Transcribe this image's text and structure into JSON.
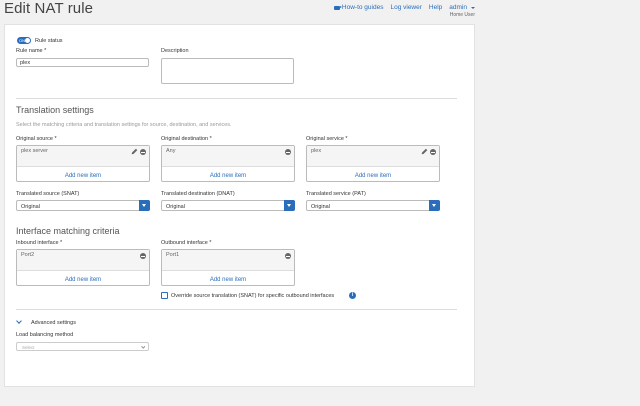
{
  "header": {
    "title": "Edit NAT rule",
    "nav": {
      "guides": "How-to guides",
      "log_viewer": "Log viewer",
      "help": "Help",
      "user": "admin",
      "role": "Home User"
    }
  },
  "form": {
    "toggle_label": "ON",
    "rule_status_label": "Rule status",
    "rule_name_label": "Rule name *",
    "rule_name_value": "plex",
    "description_label": "Description",
    "description_value": ""
  },
  "translation": {
    "title": "Translation settings",
    "helper": "Select the matching criteria and translation settings for source, destination, and services.",
    "original_source": {
      "label": "Original source *",
      "value": "plex server",
      "add": "Add new item"
    },
    "original_destination": {
      "label": "Original destination *",
      "value": "Any",
      "add": "Add new item"
    },
    "original_service": {
      "label": "Original service *",
      "value": "plex",
      "add": "Add new item"
    },
    "translated_source": {
      "label": "Translated source (SNAT)",
      "value": "Original"
    },
    "translated_destination": {
      "label": "Translated destination (DNAT)",
      "value": "Original"
    },
    "translated_service": {
      "label": "Translated service (PAT)",
      "value": "Original"
    }
  },
  "interface": {
    "title": "Interface matching criteria",
    "inbound": {
      "label": "Inbound interface *",
      "value": "Port2",
      "add": "Add new item"
    },
    "outbound": {
      "label": "Outbound interface *",
      "value": "Port1",
      "add": "Add new item"
    },
    "override_label": "Override source translation (SNAT) for specific outbound interfaces",
    "override_checked": false
  },
  "advanced": {
    "title": "Advanced settings",
    "load_balancing_label": "Load balancing method",
    "load_balancing_placeholder": "Select"
  },
  "colors": {
    "accent": "#2a6ebb",
    "panel": "#ffffff",
    "background": "#f1f1f1"
  }
}
